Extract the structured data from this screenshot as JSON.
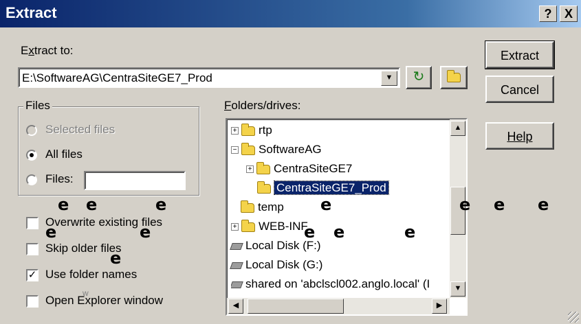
{
  "window": {
    "title": "Extract",
    "help_btn": "?",
    "close_btn": "X"
  },
  "extract_to": {
    "label": "Extract to:",
    "path": "E:\\SoftwareAG\\CentraSiteGE7_Prod"
  },
  "buttons": {
    "extract": "Extract",
    "cancel": "Cancel",
    "help": "Help"
  },
  "files_group": {
    "label": "Files",
    "options": [
      {
        "label": "Selected files",
        "selected": false,
        "enabled": false
      },
      {
        "label": "All files",
        "selected": true,
        "enabled": true
      },
      {
        "label": "Files:",
        "selected": false,
        "enabled": true
      }
    ],
    "files_value": ""
  },
  "checkboxes": [
    {
      "label": "Overwrite existing files",
      "checked": false
    },
    {
      "label": "Skip older files",
      "checked": false
    },
    {
      "label": "Use folder names",
      "checked": true
    },
    {
      "label": "Open Explorer window",
      "checked": false
    }
  ],
  "folders": {
    "label": "Folders/drives:",
    "items": [
      {
        "label": "rtp",
        "expander": "+",
        "type": "folder"
      },
      {
        "label": "SoftwareAG",
        "expander": "−",
        "type": "folder"
      },
      {
        "label": "CentraSiteGE7",
        "expander": "+",
        "type": "folder"
      },
      {
        "label": "CentraSiteGE7_Prod",
        "expander": "",
        "type": "folder",
        "selected": true
      },
      {
        "label": "temp",
        "expander": "",
        "type": "folder"
      },
      {
        "label": "WEB-INF",
        "expander": "+",
        "type": "folder"
      },
      {
        "label": "Local Disk (F:)",
        "expander": "",
        "type": "disk"
      },
      {
        "label": "Local Disk (G:)",
        "expander": "",
        "type": "disk"
      },
      {
        "label": "shared on 'abclscl002.anglo.local' (I",
        "expander": "",
        "type": "disk"
      }
    ]
  },
  "artifacts": {
    "glyph": "e",
    "small": "w"
  }
}
